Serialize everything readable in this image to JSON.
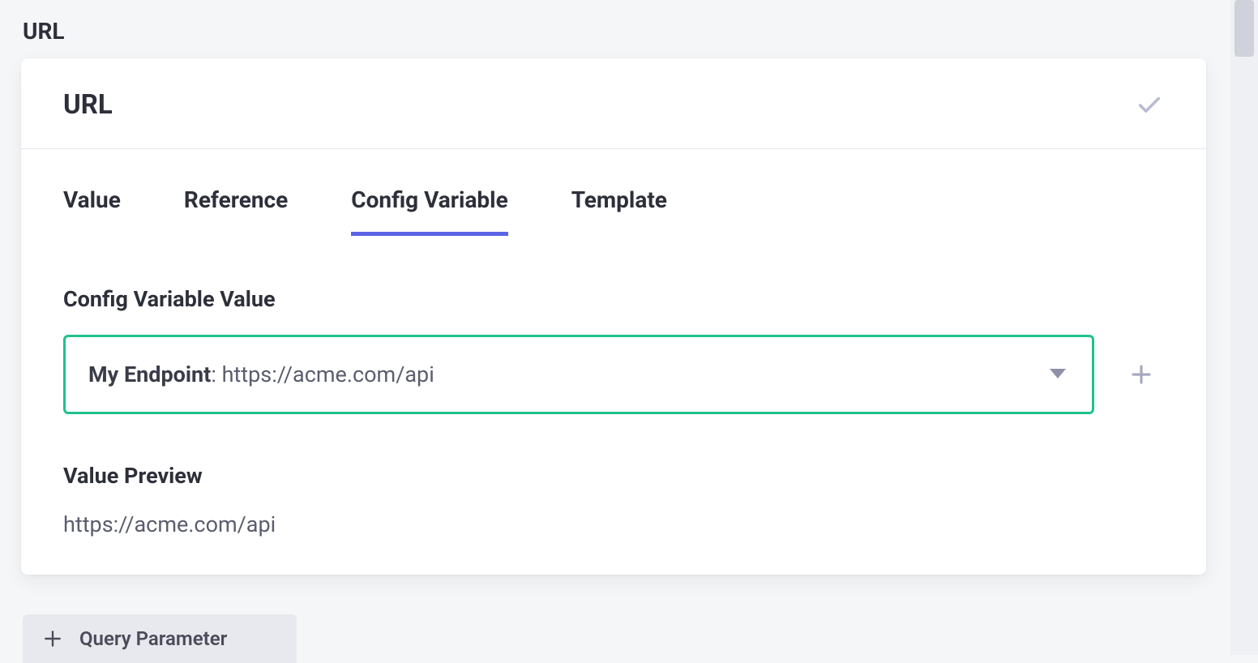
{
  "outerLabel": "URL",
  "card": {
    "title": "URL"
  },
  "tabs": [
    {
      "label": "Value"
    },
    {
      "label": "Reference"
    },
    {
      "label": "Config Variable"
    },
    {
      "label": "Template"
    }
  ],
  "configVar": {
    "label": "Config Variable Value",
    "selectedName": "My Endpoint",
    "selectedSeparator": ": ",
    "selectedValue": "https://acme.com/api"
  },
  "preview": {
    "label": "Value Preview",
    "value": "https://acme.com/api"
  },
  "queryParamBtn": {
    "label": "Query Parameter"
  }
}
